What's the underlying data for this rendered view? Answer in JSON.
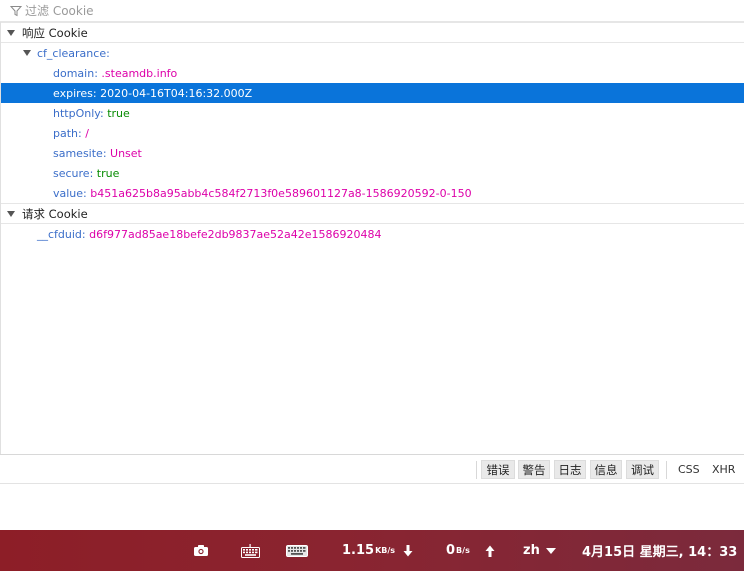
{
  "filter": {
    "placeholder": "过滤 Cookie",
    "icon": "filter-icon"
  },
  "response_section": {
    "title": "响应 Cookie",
    "cookie": {
      "name": "cf_clearance:",
      "fields": [
        {
          "key": "domain:",
          "value": ".steamdb.info",
          "type": "string",
          "selected": false
        },
        {
          "key": "expires:",
          "value": "2020-04-16T04:16:32.000Z",
          "type": "string",
          "selected": true
        },
        {
          "key": "httpOnly:",
          "value": "true",
          "type": "bool",
          "selected": false
        },
        {
          "key": "path:",
          "value": "/",
          "type": "string",
          "selected": false
        },
        {
          "key": "samesite:",
          "value": "Unset",
          "type": "string",
          "selected": false
        },
        {
          "key": "secure:",
          "value": "true",
          "type": "bool",
          "selected": false
        },
        {
          "key": "value:",
          "value": "b451a625b8a95abb4c584f2713f0e589601127a8-1586920592-0-150",
          "type": "string",
          "selected": false
        }
      ]
    }
  },
  "request_section": {
    "title": "请求 Cookie",
    "cookie": {
      "key": "__cfduid:",
      "value": "d6f977ad85ae18befe2db9837ae52a42e1586920484"
    }
  },
  "console_toolbar": {
    "errors": "错误",
    "warnings": "警告",
    "logs": "日志",
    "info": "信息",
    "debug": "调试",
    "css": "CSS",
    "xhr": "XHR"
  },
  "taskbar": {
    "screenshot_icon": "camera-icon",
    "keyboard_icon": "keyboard-icon",
    "osk_icon": "onscreen-keyboard-icon",
    "download_speed": "1.15",
    "download_unit": "KB/s",
    "upload_speed": "0",
    "upload_unit": "B/s",
    "input_method": "zh",
    "clock": "4月15日 星期三, 14：33"
  },
  "colors": {
    "selection": "#0a74da",
    "key": "#3b6ec9",
    "string_value": "#dd00a9",
    "bool_value": "#058b00",
    "taskbar": "#8a2430"
  }
}
